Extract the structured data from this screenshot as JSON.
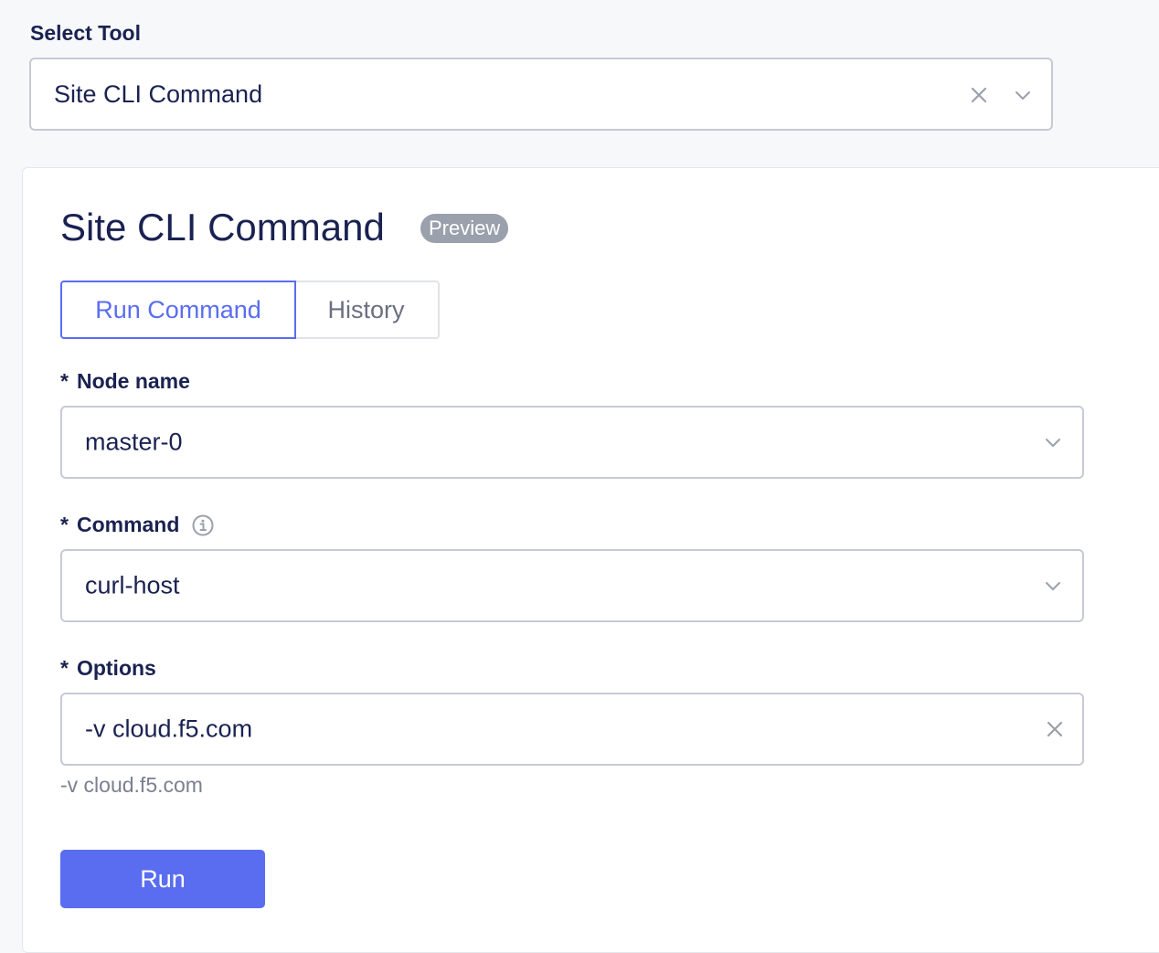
{
  "select_tool": {
    "label": "Select Tool",
    "value": "Site CLI Command"
  },
  "panel": {
    "title": "Site CLI Command",
    "badge": "Preview",
    "tabs": [
      {
        "label": "Run Command",
        "active": true
      },
      {
        "label": "History",
        "active": false
      }
    ]
  },
  "form": {
    "node_name": {
      "required_mark": "*",
      "label": "Node name",
      "value": "master-0"
    },
    "command": {
      "required_mark": "*",
      "label": "Command",
      "value": "curl-host"
    },
    "options": {
      "required_mark": "*",
      "label": "Options",
      "value": "-v cloud.f5.com",
      "helper": "-v cloud.f5.com"
    },
    "run_label": "Run"
  },
  "icons": {
    "clear": "close-icon",
    "dropdown": "chevron-down-icon",
    "info": "info-icon"
  },
  "colors": {
    "accent": "#5a6df0",
    "badge": "#9aa0ac",
    "text": "#1a2251"
  }
}
